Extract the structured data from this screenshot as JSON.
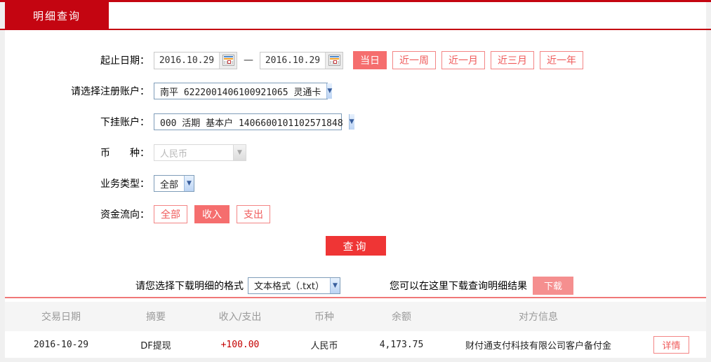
{
  "tab": {
    "label": "明细查询"
  },
  "form": {
    "date_range": {
      "label": "起止日期：",
      "start_value": "2016.10.29",
      "separator": "—",
      "end_value": "2016.10.29",
      "quick_buttons": [
        {
          "label": "当日",
          "active": true
        },
        {
          "label": "近一周",
          "active": false
        },
        {
          "label": "近一月",
          "active": false
        },
        {
          "label": "近三月",
          "active": false
        },
        {
          "label": "近一年",
          "active": false
        }
      ]
    },
    "register_account": {
      "label": "请选择注册账户：",
      "value": "南平 6222001406100921065 灵通卡"
    },
    "sub_account": {
      "label": "下挂账户：",
      "value": "000 活期 基本户 1406600101102571848"
    },
    "currency": {
      "label": "币　　种：",
      "value": "人民币",
      "disabled": true
    },
    "business_type": {
      "label": "业务类型：",
      "value": "全部"
    },
    "fund_flow": {
      "label": "资金流向：",
      "options": [
        {
          "label": "全部",
          "active": false
        },
        {
          "label": "收入",
          "active": true
        },
        {
          "label": "支出",
          "active": false
        }
      ]
    },
    "query_button": "查询"
  },
  "download": {
    "format_label": "请您选择下载明细的格式",
    "format_value": "文本格式（.txt）",
    "hint": "您可以在这里下载查询明细结果",
    "button": "下载"
  },
  "table": {
    "headers": [
      "交易日期",
      "摘要",
      "收入/支出",
      "币种",
      "余额",
      "对方信息"
    ],
    "rows": [
      {
        "date": "2016-10-29",
        "summary": "DF提现",
        "amount": "+100.00",
        "currency": "人民币",
        "balance": "4,173.75",
        "counterparty": "财付通支付科技有限公司客户备付金",
        "action": "详情"
      }
    ]
  },
  "colors": {
    "brand_red": "#c40511",
    "accent_salmon": "#f56e6e",
    "query_red": "#ef3535",
    "download_pink": "#f58f8f",
    "amount_red": "#c40000"
  }
}
